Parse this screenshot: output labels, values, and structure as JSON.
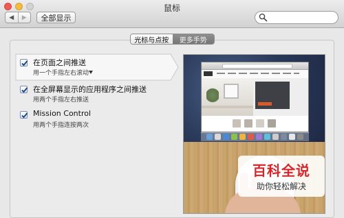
{
  "window": {
    "title": "鼠标",
    "nav_back": "◀",
    "nav_forward": "▶",
    "show_all": "全部显示",
    "search_placeholder": ""
  },
  "tabs": [
    {
      "label": "光标与点按",
      "active": true
    },
    {
      "label": "更多手势",
      "active": false
    }
  ],
  "settings": [
    {
      "label": "在页面之间推送",
      "description": "用一个手指左右滚动",
      "checked": true,
      "has_dropdown": true
    },
    {
      "label": "在全屏幕显示的应用程序之间推送",
      "description": "用两个手指左右推送",
      "checked": true,
      "has_dropdown": false
    },
    {
      "label": "Mission Control",
      "description": "用两个手指连按两次",
      "checked": true,
      "has_dropdown": false
    }
  ],
  "watermark": {
    "title": "百科全说",
    "subtitle": "助你轻松解决"
  },
  "colors": {
    "accent": "#1f5fb3",
    "watermark_red": "#d7262b"
  }
}
